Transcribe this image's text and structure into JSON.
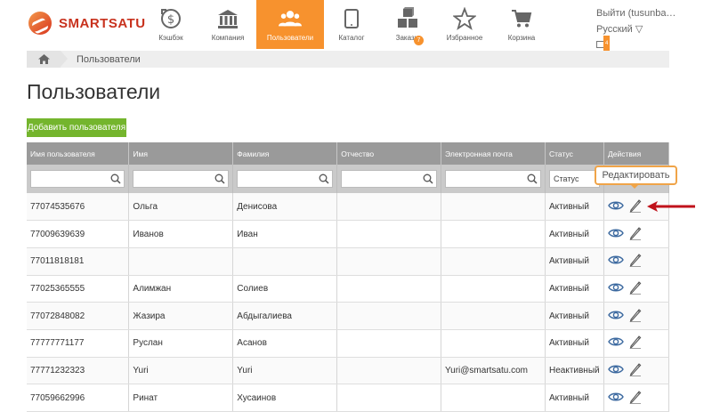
{
  "brand": {
    "name": "SMARTSATU"
  },
  "nav": [
    {
      "label": "Кэшбэк",
      "icon": "cashback-icon"
    },
    {
      "label": "Компания",
      "icon": "bank-icon"
    },
    {
      "label": "Пользователи",
      "icon": "users-icon",
      "active": true
    },
    {
      "label": "Каталог",
      "icon": "tablet-icon"
    },
    {
      "label": "Заказы",
      "icon": "boxes-icon",
      "badge": "7"
    },
    {
      "label": "Избранное",
      "icon": "star-icon"
    },
    {
      "label": "Корзина",
      "icon": "cart-icon"
    }
  ],
  "user": {
    "logout": "Выйти (tusunba…",
    "language": "Русский ▽",
    "mail_count": "4"
  },
  "breadcrumb": {
    "current": "Пользователи"
  },
  "page": {
    "title": "Пользователи",
    "add_button": "Добавить пользователя"
  },
  "table": {
    "headers": [
      "Имя пользователя",
      "Имя",
      "Фамилия",
      "Отчество",
      "Электронная почта",
      "Статус",
      "Действия"
    ],
    "status_filter": "Статус",
    "rows": [
      {
        "username": "77074535676",
        "first": "Ольга",
        "last": "Денисова",
        "middle": "",
        "email": "",
        "status": "Активный"
      },
      {
        "username": "77009639639",
        "first": "Иванов",
        "last": "Иван",
        "middle": "",
        "email": "",
        "status": "Активный"
      },
      {
        "username": "77011818181",
        "first": "",
        "last": "",
        "middle": "",
        "email": "",
        "status": "Активный"
      },
      {
        "username": "77025365555",
        "first": "Алимжан",
        "last": "Солиев",
        "middle": "",
        "email": "",
        "status": "Активный"
      },
      {
        "username": "77072848082",
        "first": "Жазира",
        "last": "Абдыгалиева",
        "middle": "",
        "email": "",
        "status": "Активный"
      },
      {
        "username": "77777771177",
        "first": "Руслан",
        "last": "Асанов",
        "middle": "",
        "email": "",
        "status": "Активный"
      },
      {
        "username": "77771232323",
        "first": "Yuri",
        "last": "Yuri",
        "middle": "",
        "email": "Yuri@smartsatu.com",
        "status": "Неактивный"
      },
      {
        "username": "77059662996",
        "first": "Ринат",
        "last": "Хусаинов",
        "middle": "",
        "email": "",
        "status": "Активный"
      }
    ]
  },
  "tooltip": {
    "text": "Редактировать"
  },
  "colors": {
    "accent": "#f7922e",
    "add_button": "#74b52d",
    "header_bg": "#9a9a9a",
    "link": "#3a84c5",
    "arrow": "#c0121b"
  }
}
